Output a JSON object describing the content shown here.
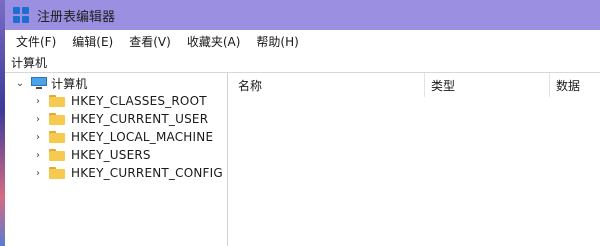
{
  "window": {
    "title": "注册表编辑器",
    "icon": "registry-editor-icon"
  },
  "menu": [
    "文件(F)",
    "编辑(E)",
    "查看(V)",
    "收藏夹(A)",
    "帮助(H)"
  ],
  "address": "计算机",
  "tree": {
    "root": {
      "label": "计算机",
      "icon": "computer-icon",
      "expanded": true
    },
    "children": [
      {
        "label": "HKEY_CLASSES_ROOT",
        "icon": "folder-icon"
      },
      {
        "label": "HKEY_CURRENT_USER",
        "icon": "folder-icon"
      },
      {
        "label": "HKEY_LOCAL_MACHINE",
        "icon": "folder-icon"
      },
      {
        "label": "HKEY_USERS",
        "icon": "folder-icon"
      },
      {
        "label": "HKEY_CURRENT_CONFIG",
        "icon": "folder-icon"
      }
    ]
  },
  "columns": {
    "name": "名称",
    "type": "类型",
    "data": "数据"
  },
  "colors": {
    "titlebar": "#9a8fe0",
    "folder": "#f6c94f",
    "computer": "#4aa3e8"
  }
}
